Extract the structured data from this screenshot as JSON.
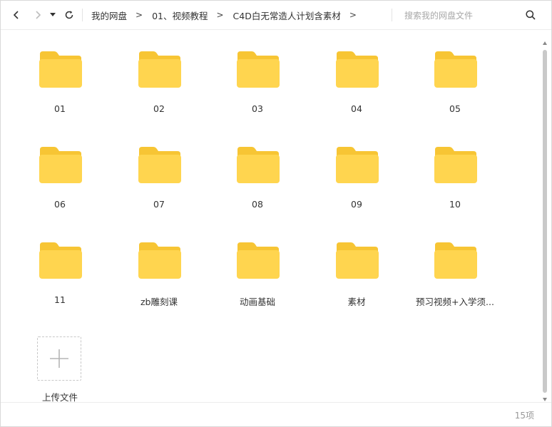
{
  "toolbar": {
    "back_icon": "chevron-left-icon",
    "forward_icon": "chevron-right-icon",
    "dropdown_icon": "caret-down-icon",
    "refresh_icon": "refresh-icon",
    "breadcrumb": [
      "我的网盘",
      "01、视频教程",
      "C4D白无常造人计划含素材"
    ],
    "breadcrumb_separator": ">",
    "search_placeholder": "搜索我的网盘文件",
    "search_icon": "search-icon"
  },
  "folders": [
    {
      "name": "01"
    },
    {
      "name": "02"
    },
    {
      "name": "03"
    },
    {
      "name": "04"
    },
    {
      "name": "05"
    },
    {
      "name": "06"
    },
    {
      "name": "07"
    },
    {
      "name": "08"
    },
    {
      "name": "09"
    },
    {
      "name": "10"
    },
    {
      "name": "11"
    },
    {
      "name": "zb雕刻课"
    },
    {
      "name": "动画基础"
    },
    {
      "name": "素材"
    },
    {
      "name": "预习视频+入学须..."
    }
  ],
  "upload": {
    "label": "上传文件",
    "icon": "plus-icon"
  },
  "footer": {
    "item_count": "15项"
  },
  "colors": {
    "folder_body": "#FFD54F",
    "folder_tab": "#F7C534",
    "accent_text": "#333333"
  }
}
